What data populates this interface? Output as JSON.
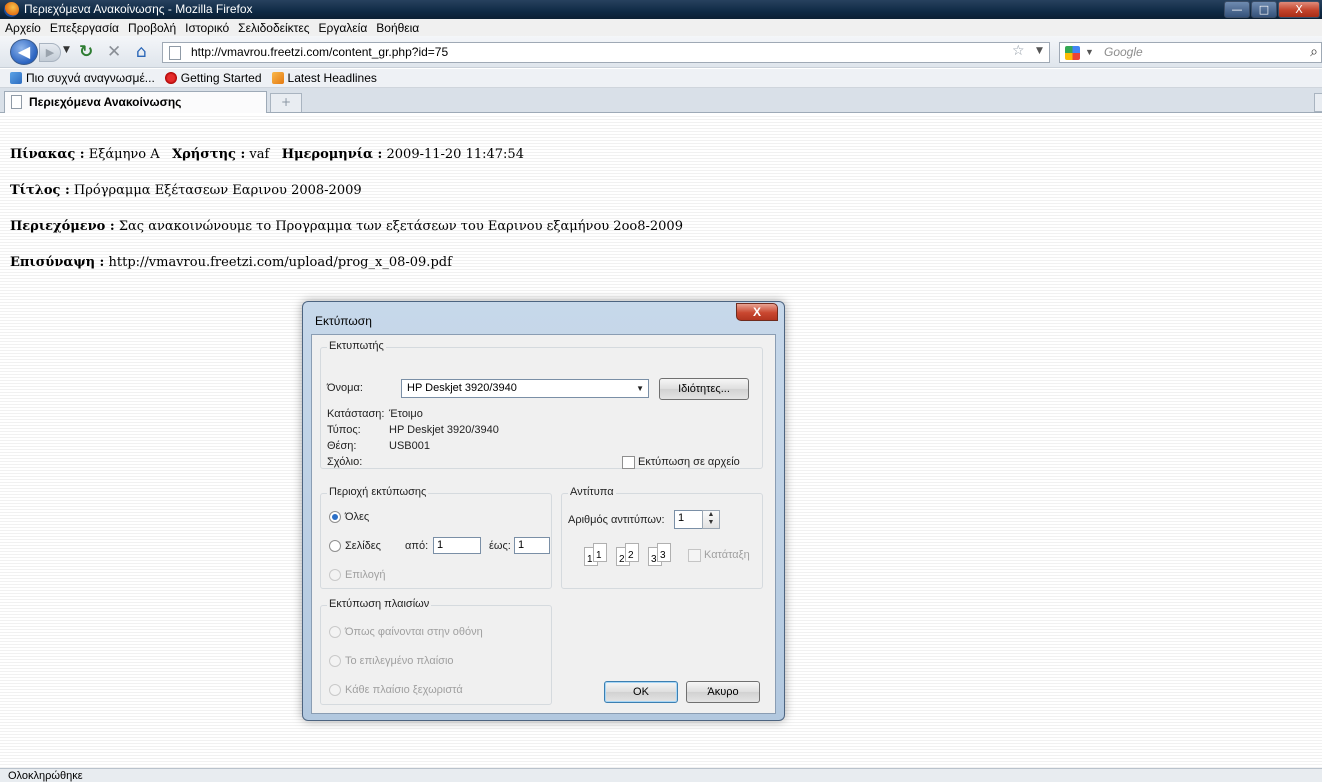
{
  "window": {
    "title": "Περιεχόμενα Ανακοίνωσης - Mozilla Firefox",
    "minimize": "—",
    "maximize": "□",
    "close": "X"
  },
  "menu": [
    "Αρχείο",
    "Επεξεργασία",
    "Προβολή",
    "Ιστορικό",
    "Σελιδοδείκτες",
    "Εργαλεία",
    "Βοήθεια"
  ],
  "nav": {
    "url": "http://vmavrou.freetzi.com/content_gr.php?id=75",
    "search_placeholder": "Google"
  },
  "bookmarks": [
    "Πιο συχνά αναγνωσμέ...",
    "Getting Started",
    "Latest Headlines"
  ],
  "tab": {
    "title": "Περιεχόμενα Ανακοίνωσης",
    "new_tab": "+"
  },
  "page": {
    "board_label": "Πίνακας :",
    "board_value": "Εξάμηνο Α",
    "user_label": "Χρήστης :",
    "user_value": "vaf",
    "date_label": "Ημερομηνία :",
    "date_value": "2009-11-20 11:47:54",
    "title_label": "Τίτλος :",
    "title_value": "Πρόγραμμα Εξέτασεων Εαρινου 2008-2009",
    "content_label": "Περιεχόμενο :",
    "content_value": "Σας ανακοινώνουμε το Προγραμμα των εξετάσεων του Εαρινου εξαμήνου 2oo8-2009",
    "attachment_label": "Επισύναψη :",
    "attachment_value": "http://vmavrou.freetzi.com/upload/prog_x_08-09.pdf"
  },
  "dialog": {
    "title": "Εκτύπωση",
    "close": "X",
    "printer_group": "Εκτυπωτής",
    "name_label": "Όνομα:",
    "name_value": "HP Deskjet 3920/3940",
    "properties_button": "Ιδιότητες...",
    "status_label": "Κατάσταση:",
    "status_value": "Έτοιμο",
    "type_label": "Τύπος:",
    "type_value": "HP Deskjet 3920/3940",
    "location_label": "Θέση:",
    "location_value": "USB001",
    "comment_label": "Σχόλιο:",
    "print_to_file": "Εκτύπωση σε αρχείο",
    "range_group": "Περιοχή εκτύπωσης",
    "range_all": "Όλες",
    "range_pages": "Σελίδες",
    "from_label": "από:",
    "from_value": "1",
    "to_label": "έως:",
    "to_value": "1",
    "range_selection": "Επιλογή",
    "copies_group": "Αντίτυπα",
    "copies_label": "Αριθμός αντιτύπων:",
    "copies_value": "1",
    "collate": "Κατάταξη",
    "frames_group": "Εκτύπωση πλαισίων",
    "frames_as_screen": "Όπως φαίνονται στην οθόνη",
    "frames_selected": "Το επιλεγμένο πλαίσιο",
    "frames_each": "Κάθε πλαίσιο ξεχωριστά",
    "ok_button": "OK",
    "cancel_button": "Άκυρο"
  },
  "status": {
    "text": "Ολοκληρώθηκε"
  }
}
